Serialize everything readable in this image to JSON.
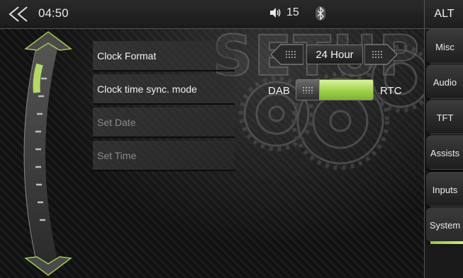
{
  "status_bar": {
    "time": "04:50",
    "volume": "15",
    "back_icon": "double-chevron-left-icon",
    "volume_icon": "speaker-icon",
    "bluetooth_icon": "bluetooth-icon"
  },
  "background_title": "SETUP",
  "tabs": {
    "alt_label": "ALT",
    "items": [
      {
        "label": "Misc"
      },
      {
        "label": "Audio"
      },
      {
        "label": "TFT"
      },
      {
        "label": "Assists"
      },
      {
        "label": "Inputs"
      },
      {
        "label": "System",
        "active": true
      }
    ]
  },
  "settings": {
    "rows": [
      {
        "label": "Clock Format",
        "enabled": true
      },
      {
        "label": "Clock time sync. mode",
        "enabled": true
      },
      {
        "label": "Set Date",
        "enabled": false
      },
      {
        "label": "Set Time",
        "enabled": false
      }
    ],
    "clock_format_value": "24 Hour",
    "sync_left_label": "DAB",
    "sync_right_label": "RTC",
    "sync_selected": "RTC"
  },
  "colors": {
    "accent": "#9ccf45",
    "accent_light": "#d8f59a"
  }
}
